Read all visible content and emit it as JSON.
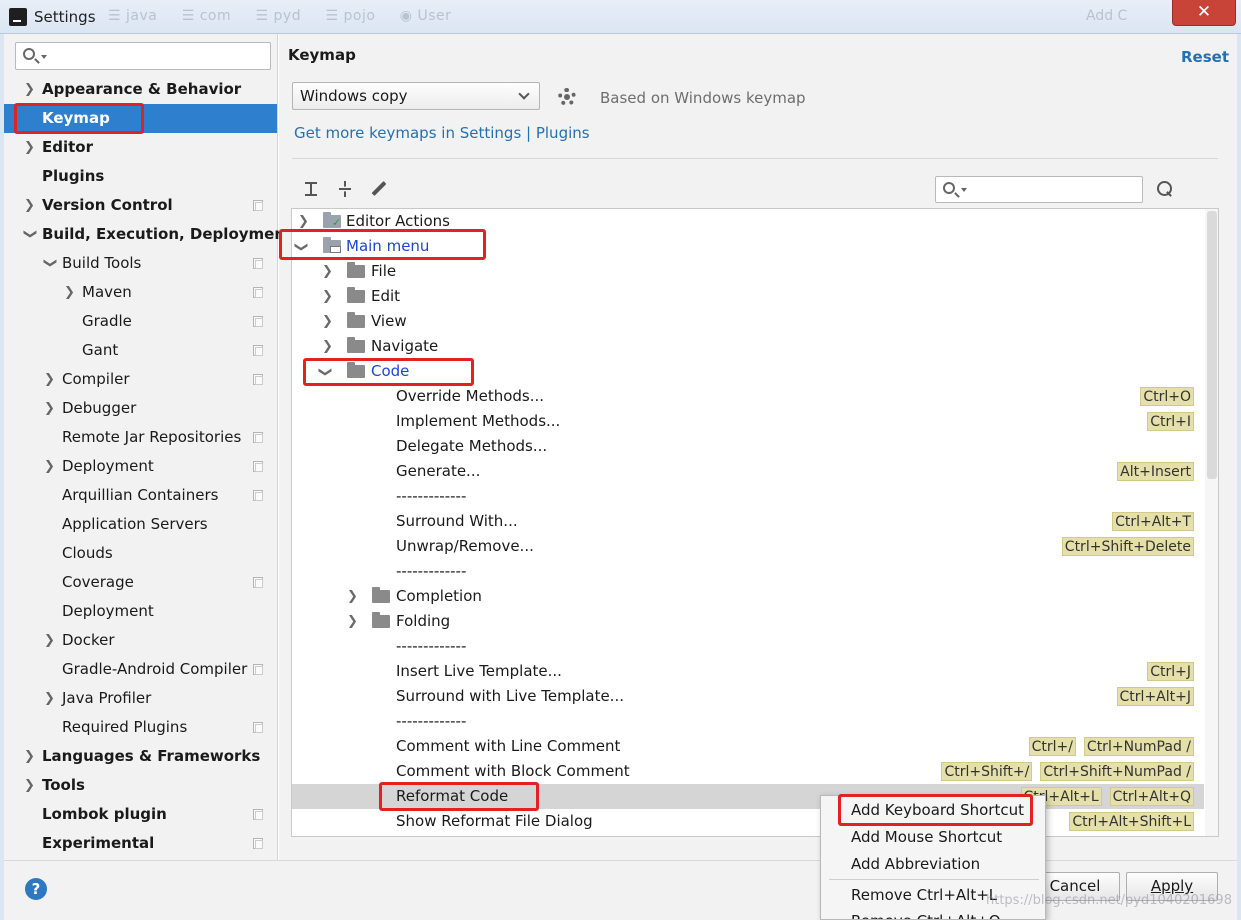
{
  "window": {
    "title": "Settings",
    "faint_title": "☰ java   ☰ com   ☰ pyd   ☰ pojo   ◉ User",
    "faint_right": "Add C",
    "close_glyph": "✕"
  },
  "sidebar": {
    "search_placeholder": "",
    "items": [
      {
        "label": "Appearance & Behavior"
      },
      {
        "label": "Keymap"
      },
      {
        "label": "Editor"
      },
      {
        "label": "Plugins"
      },
      {
        "label": "Version Control"
      },
      {
        "label": "Build, Execution, Deployment"
      },
      {
        "label": "Build Tools"
      },
      {
        "label": "Maven"
      },
      {
        "label": "Gradle"
      },
      {
        "label": "Gant"
      },
      {
        "label": "Compiler"
      },
      {
        "label": "Debugger"
      },
      {
        "label": "Remote Jar Repositories"
      },
      {
        "label": "Deployment"
      },
      {
        "label": "Arquillian Containers"
      },
      {
        "label": "Application Servers"
      },
      {
        "label": "Clouds"
      },
      {
        "label": "Coverage"
      },
      {
        "label": "Deployment"
      },
      {
        "label": "Docker"
      },
      {
        "label": "Gradle-Android Compiler"
      },
      {
        "label": "Java Profiler"
      },
      {
        "label": "Required Plugins"
      },
      {
        "label": "Languages & Frameworks"
      },
      {
        "label": "Tools"
      },
      {
        "label": "Lombok plugin"
      },
      {
        "label": "Experimental"
      }
    ]
  },
  "main": {
    "title": "Keymap",
    "reset_label": "Reset",
    "keymap_selected": "Windows copy",
    "based_on": "Based on Windows keymap",
    "more_link": "Get more keymaps in Settings | Plugins",
    "search_placeholder": ""
  },
  "tree": [
    {
      "text": "Editor Actions",
      "keys": []
    },
    {
      "text": "Main menu",
      "keys": []
    },
    {
      "text": "File",
      "keys": []
    },
    {
      "text": "Edit",
      "keys": []
    },
    {
      "text": "View",
      "keys": []
    },
    {
      "text": "Navigate",
      "keys": []
    },
    {
      "text": "Code",
      "keys": []
    },
    {
      "text": "Override Methods...",
      "keys": [
        "Ctrl+O"
      ]
    },
    {
      "text": "Implement Methods...",
      "keys": [
        "Ctrl+I"
      ]
    },
    {
      "text": "Delegate Methods...",
      "keys": []
    },
    {
      "text": "Generate...",
      "keys": [
        "Alt+Insert"
      ]
    },
    {
      "text": "-------------",
      "keys": []
    },
    {
      "text": "Surround With...",
      "keys": [
        "Ctrl+Alt+T"
      ]
    },
    {
      "text": "Unwrap/Remove...",
      "keys": [
        "Ctrl+Shift+Delete"
      ]
    },
    {
      "text": "-------------",
      "keys": []
    },
    {
      "text": "Completion",
      "keys": []
    },
    {
      "text": "Folding",
      "keys": []
    },
    {
      "text": "-------------",
      "keys": []
    },
    {
      "text": "Insert Live Template...",
      "keys": [
        "Ctrl+J"
      ]
    },
    {
      "text": "Surround with Live Template...",
      "keys": [
        "Ctrl+Alt+J"
      ]
    },
    {
      "text": "-------------",
      "keys": []
    },
    {
      "text": "Comment with Line Comment",
      "keys": [
        "Ctrl+/",
        "Ctrl+NumPad /"
      ]
    },
    {
      "text": "Comment with Block Comment",
      "keys": [
        "Ctrl+Shift+/",
        "Ctrl+Shift+NumPad /"
      ]
    },
    {
      "text": "Reformat Code",
      "keys": [
        "Ctrl+Alt+L",
        "Ctrl+Alt+Q"
      ]
    },
    {
      "text": "Show Reformat File Dialog",
      "keys": [
        "Ctrl+Alt+Shift+L"
      ]
    }
  ],
  "context_menu": {
    "items": [
      {
        "label": "Add Keyboard Shortcut"
      },
      {
        "label": "Add Mouse Shortcut"
      },
      {
        "label": "Add Abbreviation"
      },
      {
        "label": "Remove Ctrl+Alt+L"
      },
      {
        "label": "Remove Ctrl+Alt+Q"
      }
    ]
  },
  "footer": {
    "help_glyph": "?",
    "cancel_label": "Cancel",
    "apply_label": "Apply",
    "watermark": "https://blog.csdn.net/pyd1040201698"
  },
  "colors": {
    "selection": "#2f7fcf",
    "link": "#2470b3",
    "shortcut_bg": "#e5dfaa",
    "highlight_box": "#e32121",
    "tree_selected_text": "#1b45d6"
  }
}
